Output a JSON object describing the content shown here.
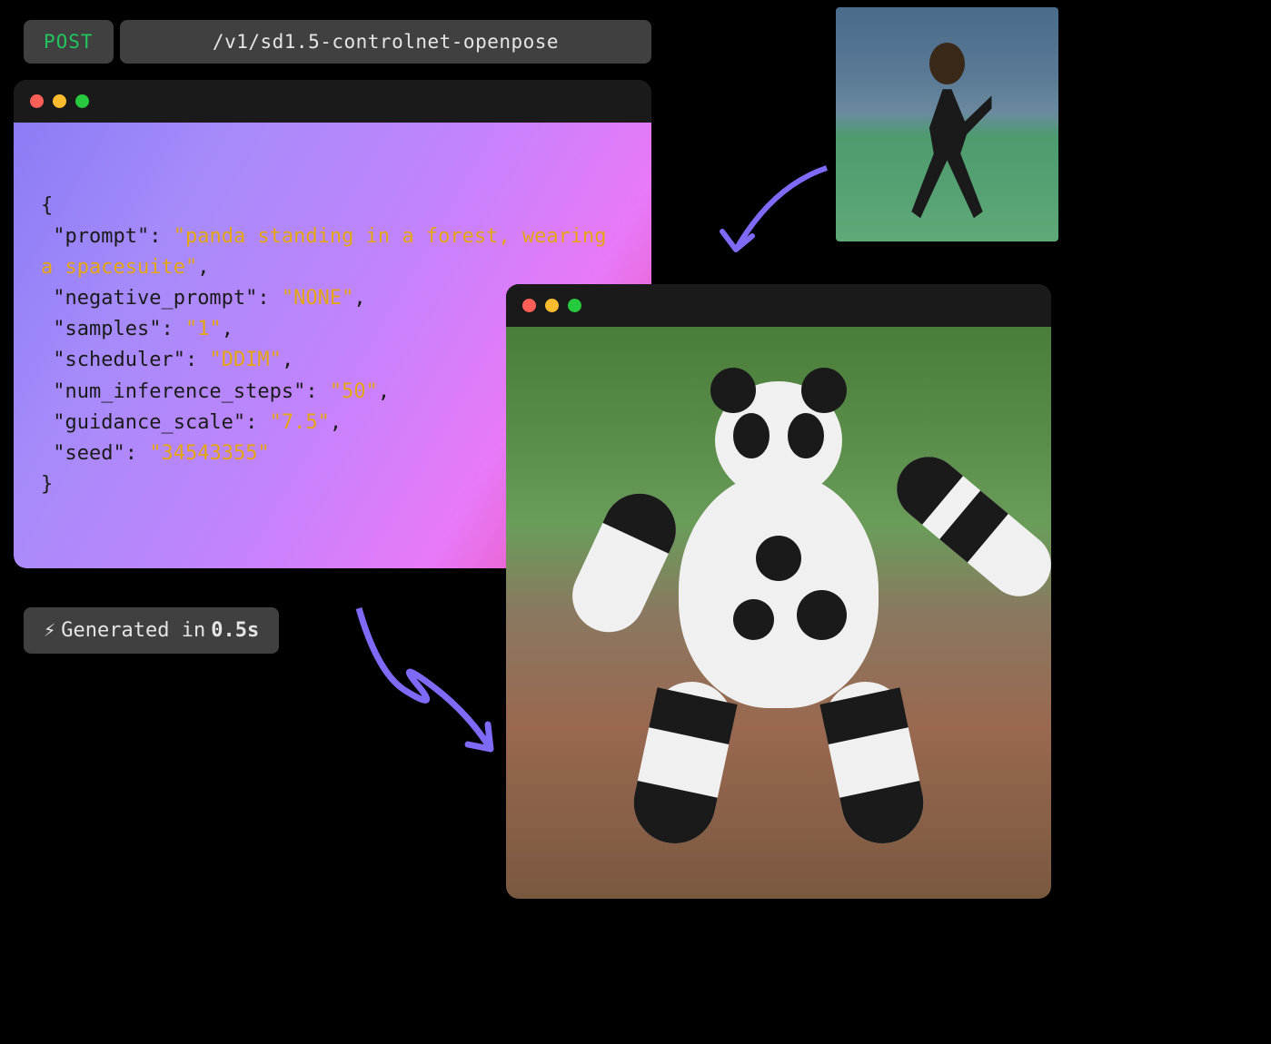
{
  "http": {
    "method": "POST",
    "endpoint": "/v1/sd1.5-controlnet-openpose"
  },
  "request_body": {
    "open_brace": "{",
    "close_brace": "}",
    "lines": [
      {
        "key": "\"prompt\"",
        "value": "\"panda standing in a forest, wearing a spacesuite\""
      },
      {
        "key": "\"negative_prompt\"",
        "value": "\"NONE\""
      },
      {
        "key": "\"samples\"",
        "value": "\"1\""
      },
      {
        "key": "\"scheduler\"",
        "value": "\"DDIM\""
      },
      {
        "key": "\"num_inference_steps\"",
        "value": "\"50\""
      },
      {
        "key": "\"guidance_scale\"",
        "value": "\"7.5\""
      },
      {
        "key": "\"seed\"",
        "value": "\"34543355\""
      }
    ]
  },
  "status": {
    "prefix": "Generated in ",
    "time": "0.5s"
  },
  "colors": {
    "accent": "#7d6bf8",
    "method_green": "#22c55e",
    "string_yellow": "#e5a611",
    "badge_bg": "#404040"
  }
}
